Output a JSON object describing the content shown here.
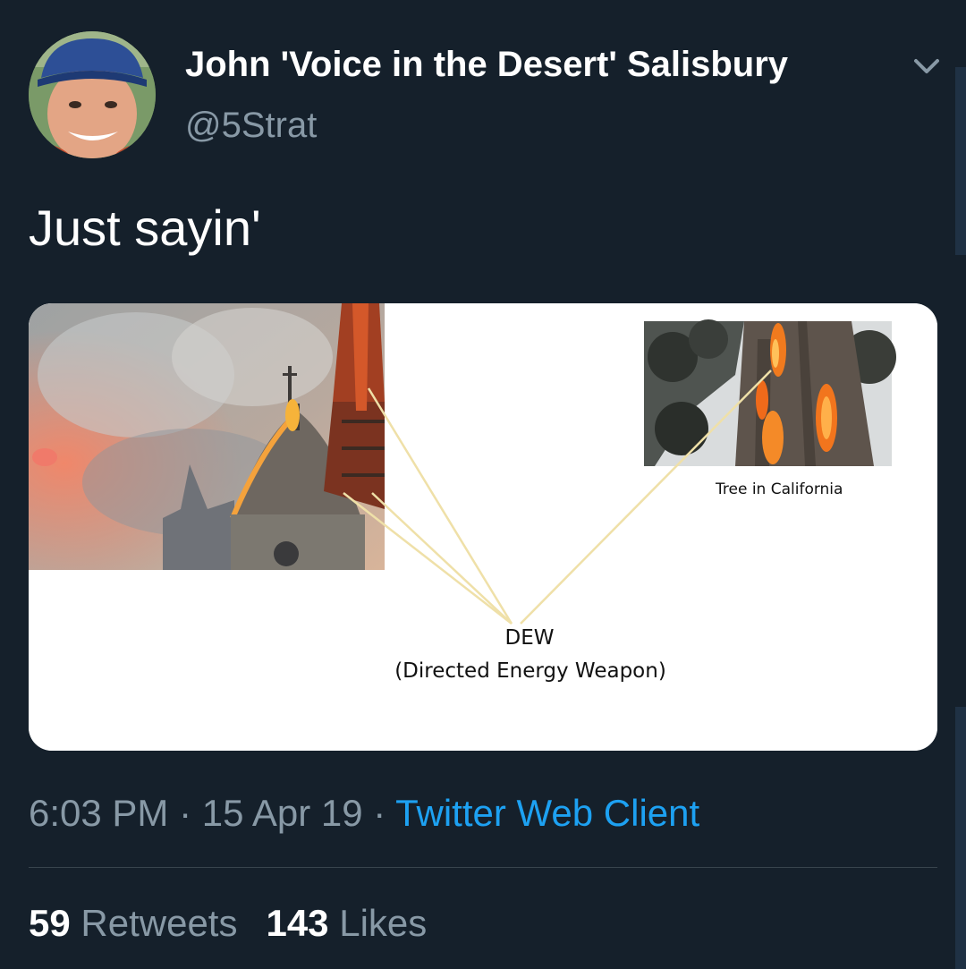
{
  "author": {
    "display_name": "John 'Voice in the Desert' Salisbury",
    "handle": "@5Strat"
  },
  "tweet": {
    "text": "Just sayin'"
  },
  "media": {
    "tree_caption": "Tree in California",
    "dew_title": "DEW",
    "dew_subtitle": "(Directed Energy Weapon)"
  },
  "meta": {
    "time": "6:03 PM",
    "separator": "·",
    "date": "15 Apr 19",
    "client": "Twitter Web Client"
  },
  "stats": {
    "retweets_count": "59",
    "retweets_label": "Retweets",
    "likes_count": "143",
    "likes_label": "Likes"
  },
  "colors": {
    "background": "#15202b",
    "secondary_text": "#8899a6",
    "link": "#1da1f2",
    "divider": "#38444d"
  },
  "icons": [
    "chevron-down-icon"
  ]
}
